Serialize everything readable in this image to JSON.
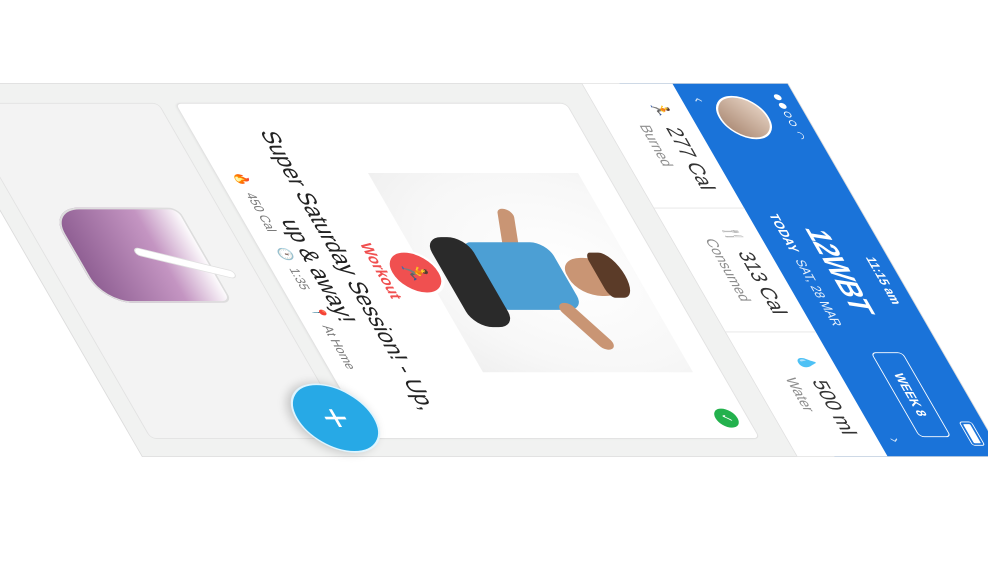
{
  "status_bar": {
    "time": "11:15 am"
  },
  "header": {
    "logo": "12WBT",
    "today_label": "TODAY",
    "date": "SAT, 28 MAR",
    "week_button": "WEEK 8",
    "accent_color": "#1a73d9"
  },
  "stats": [
    {
      "value": "277 Cal",
      "label": "Burned",
      "icon": "runner-icon",
      "color": "#e23b3b"
    },
    {
      "value": "313 Cal",
      "label": "Consumed",
      "icon": "cutlery-icon",
      "color": "#29b3a0"
    },
    {
      "value": "500 ml",
      "label": "Water",
      "icon": "water-drop-icon",
      "color": "#1a73d9"
    }
  ],
  "card": {
    "tag": "Workout",
    "title": "Super Saturday Session! - Up, up & away!",
    "calories": "450 Cal",
    "duration": "1:35",
    "location": "At Home",
    "tag_color": "#f05050"
  },
  "fab": {
    "icon": "plus-icon",
    "label": "+"
  }
}
